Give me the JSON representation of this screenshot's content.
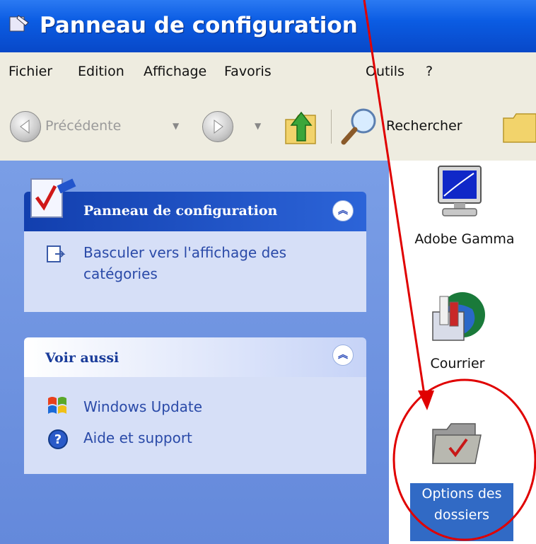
{
  "window": {
    "title": "Panneau de configuration"
  },
  "menu": [
    "Fichier",
    "Edition",
    "Affichage",
    "Favoris",
    "Outils",
    "?"
  ],
  "toolbar": {
    "back_label": "Précédente",
    "search_label": "Rechercher"
  },
  "sidebar": {
    "control_panel": {
      "title": "Panneau de configuration",
      "switch_link": [
        "Basculer vers l'affichage des",
        "catégories"
      ]
    },
    "see_also": {
      "title": "Voir aussi",
      "links": [
        "Windows Update",
        "Aide et support"
      ]
    }
  },
  "items": [
    {
      "label": "Adobe Gamma",
      "icon": "monitor-icon"
    },
    {
      "label": "Courrier",
      "icon": "mail-icon"
    },
    {
      "label_lines": [
        "Options des",
        "dossiers"
      ],
      "icon": "folder-options-icon",
      "selected": true
    }
  ],
  "colors": {
    "titlebar": "#0b5ce3",
    "sidebar": "#6e93e0",
    "panel_header": "#1a4fc7",
    "panel_body": "#d6dff7",
    "selection": "#316ac5",
    "annotation": "#e00000"
  }
}
